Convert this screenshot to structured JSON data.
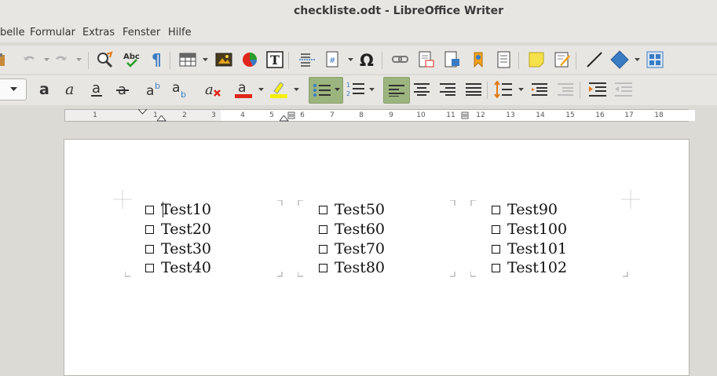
{
  "window": {
    "title": "checkliste.odt - LibreOffice Writer"
  },
  "menu": [
    "belle",
    "Formular",
    "Extras",
    "Fenster",
    "Hilfe"
  ],
  "ruler": {
    "labels": [
      "1",
      "1",
      "2",
      "3",
      "4",
      "5",
      "6",
      "7",
      "8",
      "9",
      "10",
      "11",
      "12",
      "13",
      "14",
      "15",
      "16",
      "17",
      "18"
    ]
  },
  "document": {
    "columns": [
      [
        "Test10",
        "Test20",
        "Test30",
        "Test40"
      ],
      [
        "Test50",
        "Test60",
        "Test70",
        "Test80"
      ],
      [
        "Test90",
        "Test100",
        "Test101",
        "Test102"
      ]
    ]
  },
  "colors": {
    "highlight_active": "#9cb57e",
    "font_color": "#e0261b",
    "highlight_color": "#f5f10a",
    "accent_blue": "#3a7cc4"
  }
}
